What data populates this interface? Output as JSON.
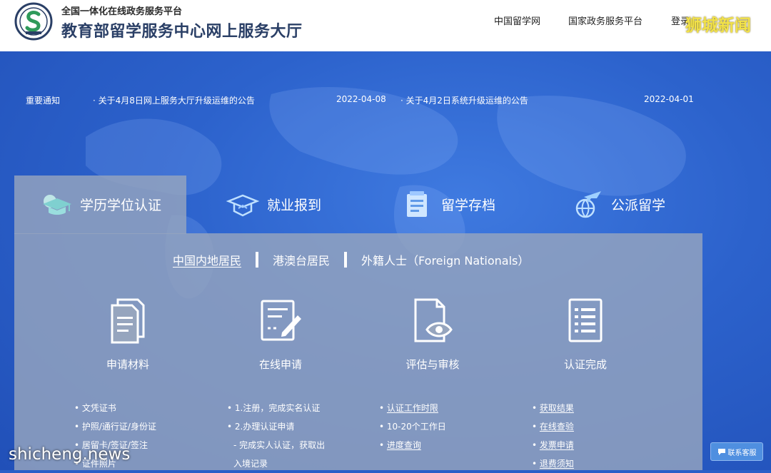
{
  "header": {
    "subtitle": "全国一体化在线政务服务平台",
    "title": "教育部留学服务中心网上服务大厅",
    "nav": [
      "中国留学网",
      "国家政务服务平台",
      "登录"
    ]
  },
  "watermarks": {
    "top": "狮城新闻",
    "bottom": "shicheng.news"
  },
  "notices": {
    "label": "重要通知",
    "items": [
      {
        "title": "· 关于4月8日网上服务大厅升级运维的公告",
        "date": "2022-04-08"
      },
      {
        "title": "· 关于4月2日系统升级运维的公告",
        "date": "2022-04-01"
      }
    ]
  },
  "tabs": [
    {
      "label": "学历学位认证",
      "icon": "graduation-cap-icon",
      "active": true
    },
    {
      "label": "就业报到",
      "icon": "hat-certificate-icon",
      "active": false
    },
    {
      "label": "留学存档",
      "icon": "archive-document-icon",
      "active": false
    },
    {
      "label": "公派留学",
      "icon": "airplane-globe-icon",
      "active": false
    }
  ],
  "sub_tabs": [
    {
      "label": "中国内地居民",
      "active": true
    },
    {
      "label": "港澳台居民",
      "active": false
    },
    {
      "label": "外籍人士（Foreign Nationals）",
      "active": false
    }
  ],
  "steps": [
    {
      "label": "申请材料",
      "icon": "documents-icon"
    },
    {
      "label": "在线申请",
      "icon": "form-pen-icon"
    },
    {
      "label": "评估与审核",
      "icon": "document-eye-icon"
    },
    {
      "label": "认证完成",
      "icon": "checklist-icon"
    }
  ],
  "columns": {
    "materials": [
      "• 文凭证书",
      "• 护照/通行证/身份证",
      "• 居留卡/签证/签注",
      "• 证件照片"
    ],
    "online": [
      "• 1.注册，完成实名认证",
      "• 2.办理认证申请",
      "- 完成实人认证，获取出",
      "入境记录"
    ],
    "review": [
      "认证工作时限",
      "10-20个工作日",
      "进度查询"
    ],
    "complete": [
      "获取结果",
      "在线查验",
      "发票申请",
      "退费须知"
    ]
  },
  "help_button": "联系客服",
  "colors": {
    "hero_blue": "#2a5fc8",
    "panel_gray": "#96a5be",
    "title_navy": "#2a3f66",
    "watermark_yellow": "#f2e24a"
  }
}
